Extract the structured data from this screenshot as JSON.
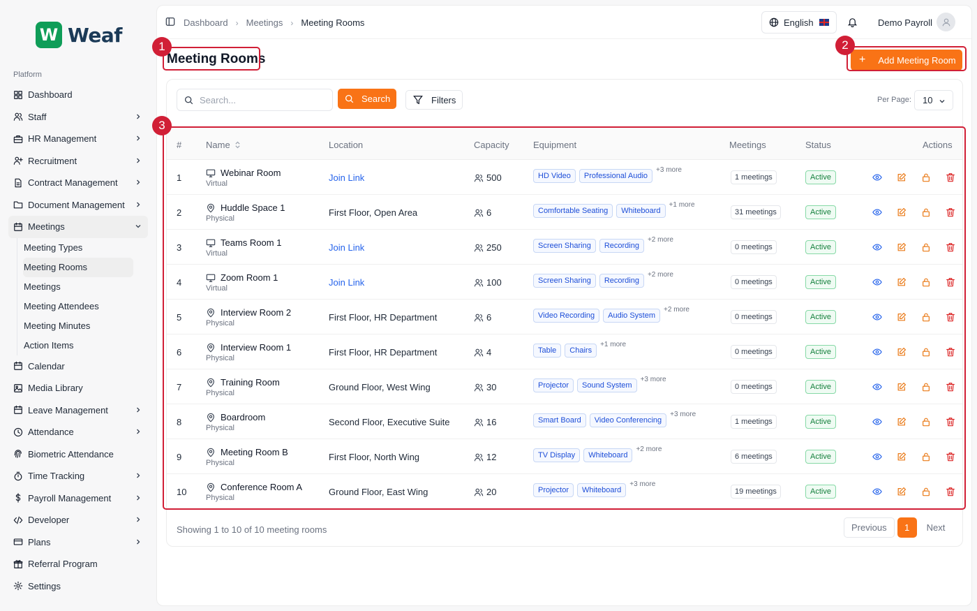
{
  "brand": {
    "logo_letter": "W",
    "logo_text": "Weaf",
    "color": "#0f9d58"
  },
  "sidebar": {
    "section": "Platform",
    "items": [
      {
        "label": "Dashboard",
        "icon": "grid-icon",
        "chevron": false
      },
      {
        "label": "Staff",
        "icon": "users-icon",
        "chevron": true
      },
      {
        "label": "HR Management",
        "icon": "briefcase-icon",
        "chevron": true
      },
      {
        "label": "Recruitment",
        "icon": "user-plus-icon",
        "chevron": true
      },
      {
        "label": "Contract Management",
        "icon": "file-icon",
        "chevron": true
      },
      {
        "label": "Document Management",
        "icon": "folder-icon",
        "chevron": true
      },
      {
        "label": "Meetings",
        "icon": "calendar-icon",
        "chevron": true,
        "open": true
      }
    ],
    "meetings_sub": [
      "Meeting Types",
      "Meeting Rooms",
      "Meetings",
      "Meeting Attendees",
      "Meeting Minutes",
      "Action Items"
    ],
    "items_after": [
      {
        "label": "Calendar",
        "icon": "calendar-icon",
        "chevron": false
      },
      {
        "label": "Media Library",
        "icon": "image-icon",
        "chevron": false
      },
      {
        "label": "Leave Management",
        "icon": "calendar-icon",
        "chevron": true
      },
      {
        "label": "Attendance",
        "icon": "clock-icon",
        "chevron": true
      },
      {
        "label": "Biometric Attendance",
        "icon": "fingerprint-icon",
        "chevron": false
      },
      {
        "label": "Time Tracking",
        "icon": "timer-icon",
        "chevron": true
      },
      {
        "label": "Payroll Management",
        "icon": "dollar-icon",
        "chevron": true
      },
      {
        "label": "Developer",
        "icon": "code-icon",
        "chevron": true
      },
      {
        "label": "Plans",
        "icon": "card-icon",
        "chevron": true
      },
      {
        "label": "Referral Program",
        "icon": "gift-icon",
        "chevron": false
      },
      {
        "label": "Settings",
        "icon": "gear-icon",
        "chevron": false
      }
    ]
  },
  "header": {
    "breadcrumbs": [
      "Dashboard",
      "Meetings",
      "Meeting Rooms"
    ],
    "language": "English",
    "user_name": "Demo Payroll"
  },
  "page": {
    "title": "Meeting Rooms",
    "add_button": "Add Meeting Room",
    "search_placeholder": "Search...",
    "search_button": "Search",
    "filters_button": "Filters",
    "per_page_label": "Per Page:",
    "per_page_value": "10",
    "accent": "#f97316"
  },
  "table": {
    "columns": [
      "#",
      "Name",
      "Location",
      "Capacity",
      "Equipment",
      "Meetings",
      "Status",
      "Actions"
    ],
    "rows": [
      {
        "num": "1",
        "name": "Webinar Room",
        "type": "Virtual",
        "location": "Join Link",
        "link": true,
        "capacity": "500",
        "equipment": [
          "HD Video",
          "Professional Audio"
        ],
        "more": "+3 more",
        "meetings": "1 meetings",
        "status": "Active"
      },
      {
        "num": "2",
        "name": "Huddle Space 1",
        "type": "Physical",
        "location": "First Floor, Open Area",
        "link": false,
        "capacity": "6",
        "equipment": [
          "Comfortable Seating",
          "Whiteboard"
        ],
        "more": "+1 more",
        "meetings": "31 meetings",
        "status": "Active"
      },
      {
        "num": "3",
        "name": "Teams Room 1",
        "type": "Virtual",
        "location": "Join Link",
        "link": true,
        "capacity": "250",
        "equipment": [
          "Screen Sharing",
          "Recording"
        ],
        "more": "+2 more",
        "meetings": "0 meetings",
        "status": "Active"
      },
      {
        "num": "4",
        "name": "Zoom Room 1",
        "type": "Virtual",
        "location": "Join Link",
        "link": true,
        "capacity": "100",
        "equipment": [
          "Screen Sharing",
          "Recording"
        ],
        "more": "+2 more",
        "meetings": "0 meetings",
        "status": "Active"
      },
      {
        "num": "5",
        "name": "Interview Room 2",
        "type": "Physical",
        "location": "First Floor, HR Department",
        "link": false,
        "capacity": "6",
        "equipment": [
          "Video Recording",
          "Audio System"
        ],
        "more": "+2 more",
        "meetings": "0 meetings",
        "status": "Active"
      },
      {
        "num": "6",
        "name": "Interview Room 1",
        "type": "Physical",
        "location": "First Floor, HR Department",
        "link": false,
        "capacity": "4",
        "equipment": [
          "Table",
          "Chairs"
        ],
        "more": "+1 more",
        "meetings": "0 meetings",
        "status": "Active"
      },
      {
        "num": "7",
        "name": "Training Room",
        "type": "Physical",
        "location": "Ground Floor, West Wing",
        "link": false,
        "capacity": "30",
        "equipment": [
          "Projector",
          "Sound System"
        ],
        "more": "+3 more",
        "meetings": "0 meetings",
        "status": "Active"
      },
      {
        "num": "8",
        "name": "Boardroom",
        "type": "Physical",
        "location": "Second Floor, Executive Suite",
        "link": false,
        "capacity": "16",
        "equipment": [
          "Smart Board",
          "Video Conferencing"
        ],
        "more": "+3 more",
        "meetings": "1 meetings",
        "status": "Active"
      },
      {
        "num": "9",
        "name": "Meeting Room B",
        "type": "Physical",
        "location": "First Floor, North Wing",
        "link": false,
        "capacity": "12",
        "equipment": [
          "TV Display",
          "Whiteboard"
        ],
        "more": "+2 more",
        "meetings": "6 meetings",
        "status": "Active"
      },
      {
        "num": "10",
        "name": "Conference Room A",
        "type": "Physical",
        "location": "Ground Floor, East Wing",
        "link": false,
        "capacity": "20",
        "equipment": [
          "Projector",
          "Whiteboard"
        ],
        "more": "+3 more",
        "meetings": "19 meetings",
        "status": "Active"
      }
    ]
  },
  "footer": {
    "showing": "Showing 1 to 10 of 10 meeting rooms",
    "previous": "Previous",
    "page": "1",
    "next": "Next"
  },
  "annotations": [
    "1",
    "2",
    "3"
  ]
}
